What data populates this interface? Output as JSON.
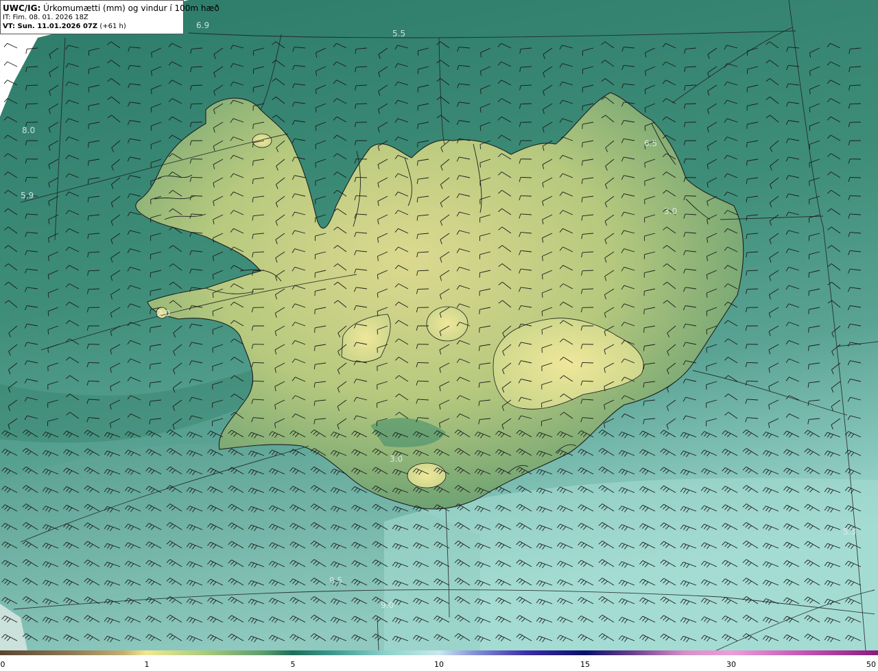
{
  "header": {
    "model": "UWC/IG:",
    "title": "Úrkomumætti (mm) og vindur í 100m hæð",
    "issue_time": "IT: Fim. 08. 01. 2026 18Z",
    "valid_prefix": "VT: Sun. 11.01.2026 07Z",
    "valid_suffix": "(+61 h)"
  },
  "contour_labels": [
    "6.9",
    "5.5",
    "8.0",
    "6.5",
    "5.9",
    "3.0",
    "2.0",
    "3.0",
    "5.3",
    "9.5",
    "9.0"
  ],
  "colorbar": {
    "ticks": [
      "0",
      "1",
      "5",
      "10",
      "15",
      "30",
      "50"
    ],
    "colors": {
      "brown": "#5a4532",
      "yellow": "#f1e891",
      "dark_green": "#1f6d5b",
      "light_cyan": "#cbe8ee",
      "navy": "#0d0f6a",
      "pink": "#ec9ed8",
      "magenta": "#8a1b7c"
    }
  },
  "map_colors": {
    "sea_deep": "#2f7e6e",
    "sea_light": "#8fcfc6",
    "land": "#b3c97f",
    "highland": "#d7d98c",
    "lines": "#1c1c1c"
  }
}
